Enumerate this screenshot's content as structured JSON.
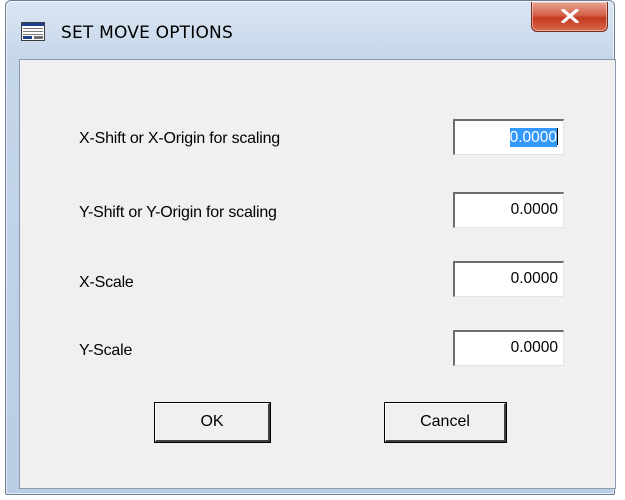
{
  "window": {
    "title": "SET MOVE OPTIONS",
    "icon": "grid-app-icon",
    "close_icon": "close-x-icon"
  },
  "fields": [
    {
      "label": "X-Shift  or X-Origin for scaling",
      "value": "0.0000",
      "selected": true
    },
    {
      "label": "Y-Shift  or Y-Origin for scaling",
      "value": "0.0000",
      "selected": false
    },
    {
      "label": "X-Scale",
      "value": "0.0000",
      "selected": false
    },
    {
      "label": "Y-Scale",
      "value": "0.0000",
      "selected": false
    }
  ],
  "buttons": {
    "ok_label": "OK",
    "cancel_label": "Cancel"
  },
  "colors": {
    "selection": "#3399ff",
    "close_button": "#c2391f",
    "dialog_face": "#f0f0f0"
  }
}
